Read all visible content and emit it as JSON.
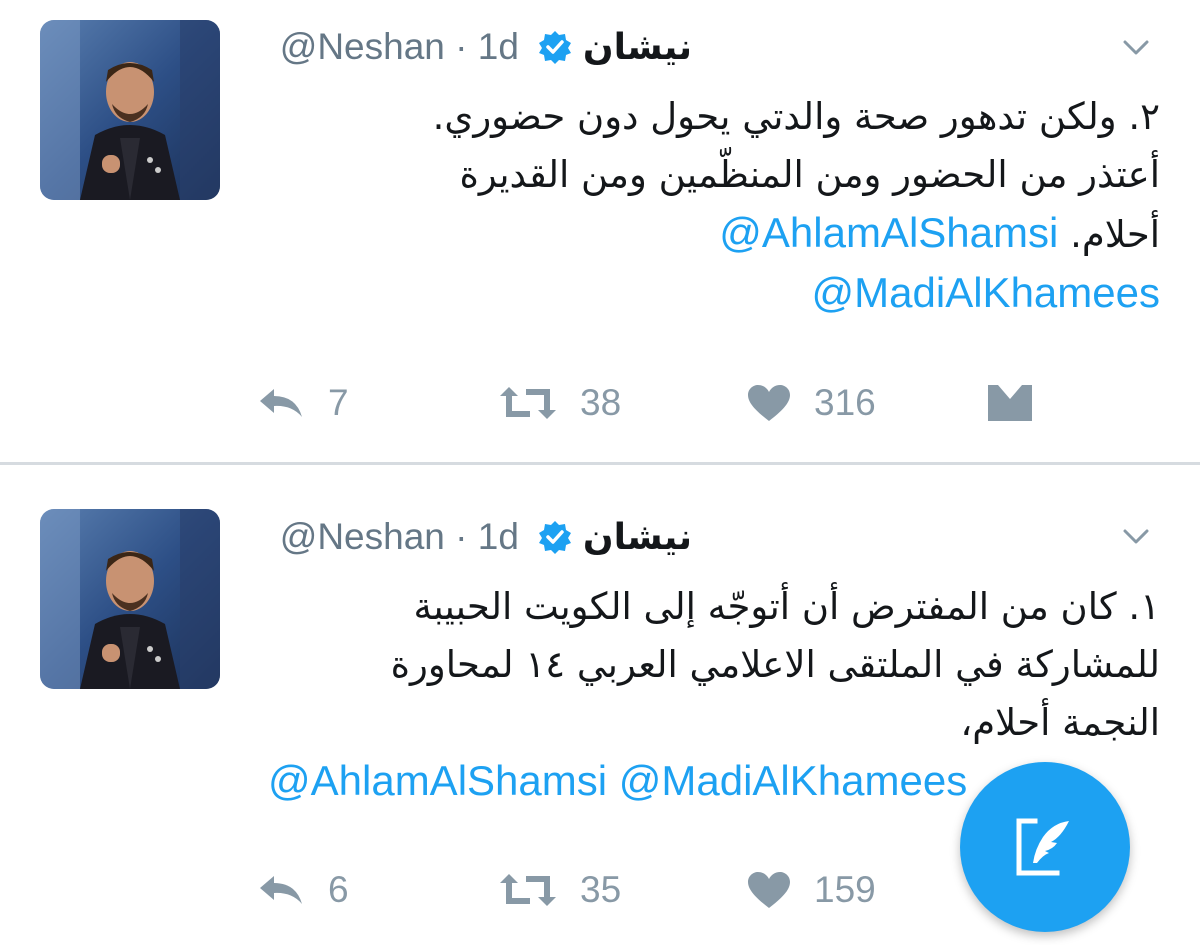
{
  "app": {
    "accent_color": "#1da1f2",
    "secondary_text_color": "#657786"
  },
  "tweets": [
    {
      "display_name": "نيشان",
      "handle": "@Neshan · 1d",
      "verified": true,
      "text_lines": [
        "٢. ولكن تدهور صحة والدتي يحول دون حضوري.",
        "أعتذر من الحضور ومن المنظّمين ومن القديرة",
        "أحلام."
      ],
      "mentions": [
        "@AhlamAlShamsi",
        "@MadiAlKhamees"
      ],
      "reply_count": "7",
      "retweet_count": "38",
      "like_count": "316",
      "icons": [
        "reply-icon",
        "retweet-icon",
        "heart-icon",
        "direct-message-icon",
        "chevron-down-icon",
        "verified-badge-icon"
      ]
    },
    {
      "display_name": "نيشان",
      "handle": "@Neshan · 1d",
      "verified": true,
      "text_lines": [
        "١. كان من المفترض أن أتوجّه إلى الكويت الحبيبة",
        "للمشاركة في الملتقى الاعلامي العربي ١٤ لمحاورة",
        "النجمة أحلام،"
      ],
      "mentions_text": "@AhlamAlShamsi @MadiAlKhamees",
      "reply_count": "6",
      "retweet_count": "35",
      "like_count": "159"
    }
  ],
  "compose_button": {
    "icon": "compose-tweet-icon"
  }
}
